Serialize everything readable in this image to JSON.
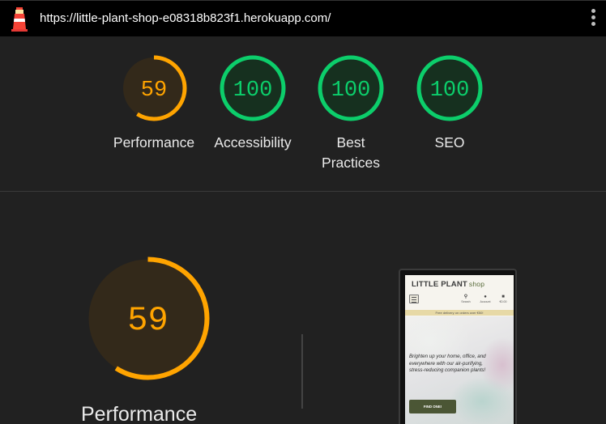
{
  "browser": {
    "url": "https://little-plant-shop-e08318b823f1.herokuapp.com/",
    "logo_icon": "lighthouse-icon",
    "menu_icon": "vertical-ellipsis-icon"
  },
  "colors": {
    "average": "#ffa400",
    "pass": "#0cce6b",
    "background": "#212121",
    "topbar": "#000000"
  },
  "summary": {
    "gauges": [
      {
        "score": "59",
        "label": "Performance",
        "rating": "average"
      },
      {
        "score": "100",
        "label": "Accessibility",
        "rating": "pass"
      },
      {
        "score": "100",
        "label": "Best Practices",
        "rating": "pass"
      },
      {
        "score": "100",
        "label": "SEO",
        "rating": "pass"
      }
    ]
  },
  "detail": {
    "score": "59",
    "label": "Performance"
  },
  "screenshot": {
    "brand": "LITTLE PLANT",
    "brand_suffix": "shop",
    "nav": [
      {
        "icon": "search-icon",
        "label": "Search"
      },
      {
        "icon": "account-icon",
        "label": "Account"
      },
      {
        "icon": "bag-icon",
        "label": "€0.00"
      }
    ],
    "banner": "Free delivery on orders over €50!",
    "tagline": "Brighten up your home, office, and everywhere with our air-purifying, stress-reducing companion plants!",
    "cta": "FIND ONE!"
  }
}
